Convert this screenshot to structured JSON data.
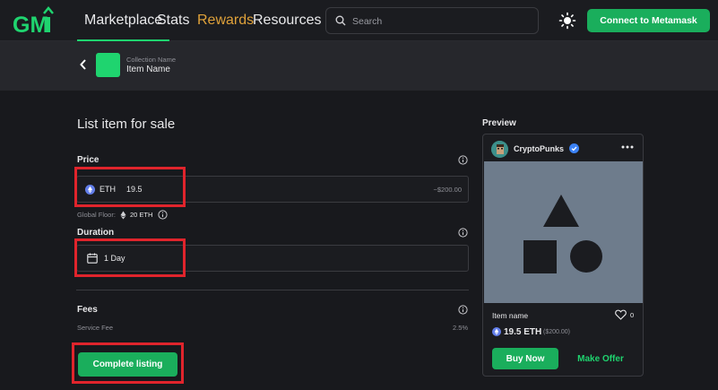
{
  "nav": {
    "logo_text": "GMI",
    "items": [
      {
        "label": "Marketplace"
      },
      {
        "label": "Stats"
      },
      {
        "label": "Rewards"
      },
      {
        "label": "Resources"
      }
    ],
    "search_placeholder": "Search",
    "theme_icon": "sun-icon",
    "connect_label": "Connect to Metamask"
  },
  "breadcrumb": {
    "collection_name": "Collection Name",
    "item_name": "Item Name"
  },
  "listing": {
    "title": "List item for sale",
    "price_label": "Price",
    "currency": "ETH",
    "price_value": "19.5",
    "price_usd": "~$200.00",
    "floor_label": "Global Floor:",
    "floor_value": "20 ETH",
    "duration_label": "Duration",
    "duration_value": "1 Day",
    "fees_label": "Fees",
    "service_fee_label": "Service Fee",
    "service_fee_value": "2.5%",
    "complete_label": "Complete listing"
  },
  "preview": {
    "title": "Preview",
    "creator": "CryptoPunks",
    "item_name": "Item name",
    "likes": "0",
    "price": "19.5 ETH",
    "price_usd": "($200.00)",
    "buy_label": "Buy Now",
    "offer_label": "Make Offer"
  },
  "colors": {
    "accent": "#1aae5c",
    "rewards": "#e0a23a",
    "highlight": "#e0242c",
    "background": "#18191d"
  }
}
